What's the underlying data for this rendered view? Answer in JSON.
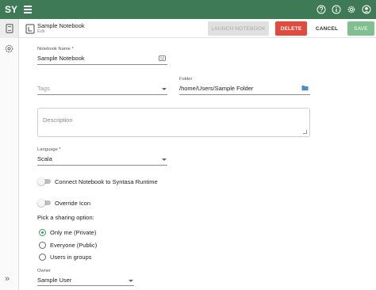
{
  "app": {
    "logo": "SY"
  },
  "header": {
    "title": "Sample Notebook",
    "subtitle": "Edit",
    "launch_label": "LAUNCH NOTEBOOK",
    "delete_label": "DELETE",
    "cancel_label": "CANCEL",
    "save_label": "SAVE"
  },
  "form": {
    "name": {
      "label": "Notebook Name *",
      "value": "Sample Notebook"
    },
    "tags": {
      "placeholder": "Tags"
    },
    "folder": {
      "label": "Folder",
      "value": "/home/Users/Sample Folder"
    },
    "description": {
      "placeholder": "Description"
    },
    "language": {
      "label": "Language *",
      "value": "Scala"
    },
    "connect_runtime": {
      "label": "Connect Notebook to Syntasa Runtime",
      "enabled": false
    },
    "override_icon": {
      "label": "Override Icon",
      "enabled": false
    },
    "sharing": {
      "prompt": "Pick a sharing option:",
      "options": [
        {
          "label": "Only me (Private)",
          "selected": true
        },
        {
          "label": "Everyone (Public)",
          "selected": false
        },
        {
          "label": "Users in groups",
          "selected": false
        }
      ]
    },
    "owner": {
      "label": "Owner",
      "value": "Sample User"
    }
  },
  "icons": {
    "top_bar": [
      "help-icon",
      "info-icon",
      "settings-icon",
      "account-icon"
    ],
    "rail": [
      "notebook-icon",
      "runtime-icon",
      "expand-icon"
    ]
  },
  "colors": {
    "app_bar": "#3e7a55",
    "delete": "#e04b3e",
    "save": "#7fbf90",
    "radio_accent": "#3e9a5c"
  }
}
